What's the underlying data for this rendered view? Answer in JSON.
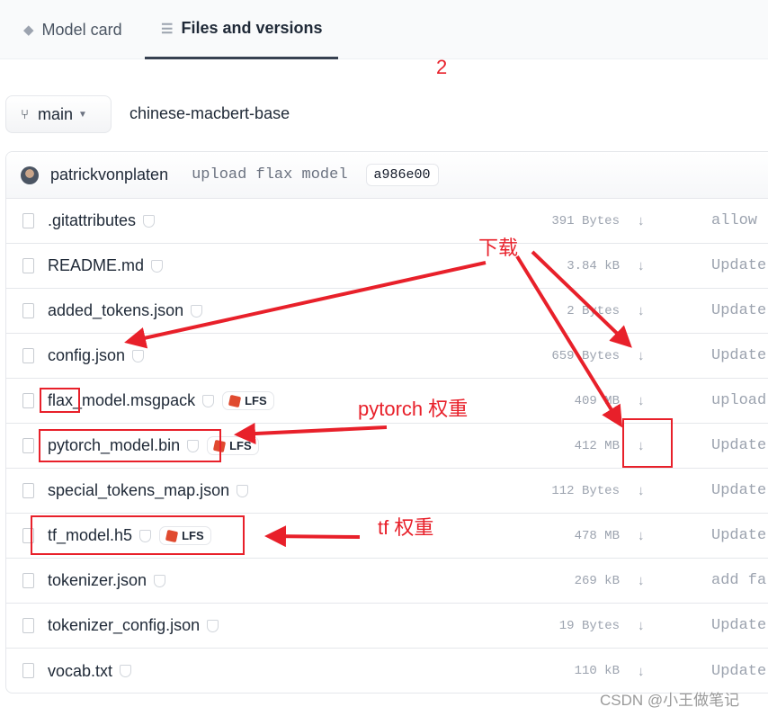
{
  "tabs": [
    {
      "label": "Model card",
      "icon": "cube-icon"
    },
    {
      "label": "Files and versions",
      "icon": "files-icon",
      "active": true
    }
  ],
  "branch": {
    "label": "main",
    "icon": "git-branch-icon"
  },
  "repo_name": "chinese-macbert-base",
  "commit": {
    "author": "patrickvonplaten",
    "message": "upload flax model",
    "sha": "a986e00"
  },
  "files": [
    {
      "name": ".gitattributes",
      "lfs": false,
      "size": "391 Bytes",
      "commit": "allow"
    },
    {
      "name": "README.md",
      "lfs": false,
      "size": "3.84 kB",
      "commit": "Update"
    },
    {
      "name": "added_tokens.json",
      "lfs": false,
      "size": "2 Bytes",
      "commit": "Update"
    },
    {
      "name": "config.json",
      "lfs": false,
      "size": "659 Bytes",
      "commit": "Update"
    },
    {
      "name": "flax_model.msgpack",
      "lfs": true,
      "size": "409 MB",
      "commit": "upload"
    },
    {
      "name": "pytorch_model.bin",
      "lfs": true,
      "size": "412 MB",
      "commit": "Update"
    },
    {
      "name": "special_tokens_map.json",
      "lfs": false,
      "size": "112 Bytes",
      "commit": "Update"
    },
    {
      "name": "tf_model.h5",
      "lfs": true,
      "size": "478 MB",
      "commit": "Update"
    },
    {
      "name": "tokenizer.json",
      "lfs": false,
      "size": "269 kB",
      "commit": "add fa"
    },
    {
      "name": "tokenizer_config.json",
      "lfs": false,
      "size": "19 Bytes",
      "commit": "Update"
    },
    {
      "name": "vocab.txt",
      "lfs": false,
      "size": "110 kB",
      "commit": "Update"
    }
  ],
  "lfs_label": "LFS",
  "download_icon": "↓",
  "annotations": {
    "number": "2",
    "download": "下载",
    "pytorch": "pytorch 权重",
    "tf": "tf 权重",
    "color": "#e8202a"
  },
  "watermark": "CSDN @小王做笔记"
}
